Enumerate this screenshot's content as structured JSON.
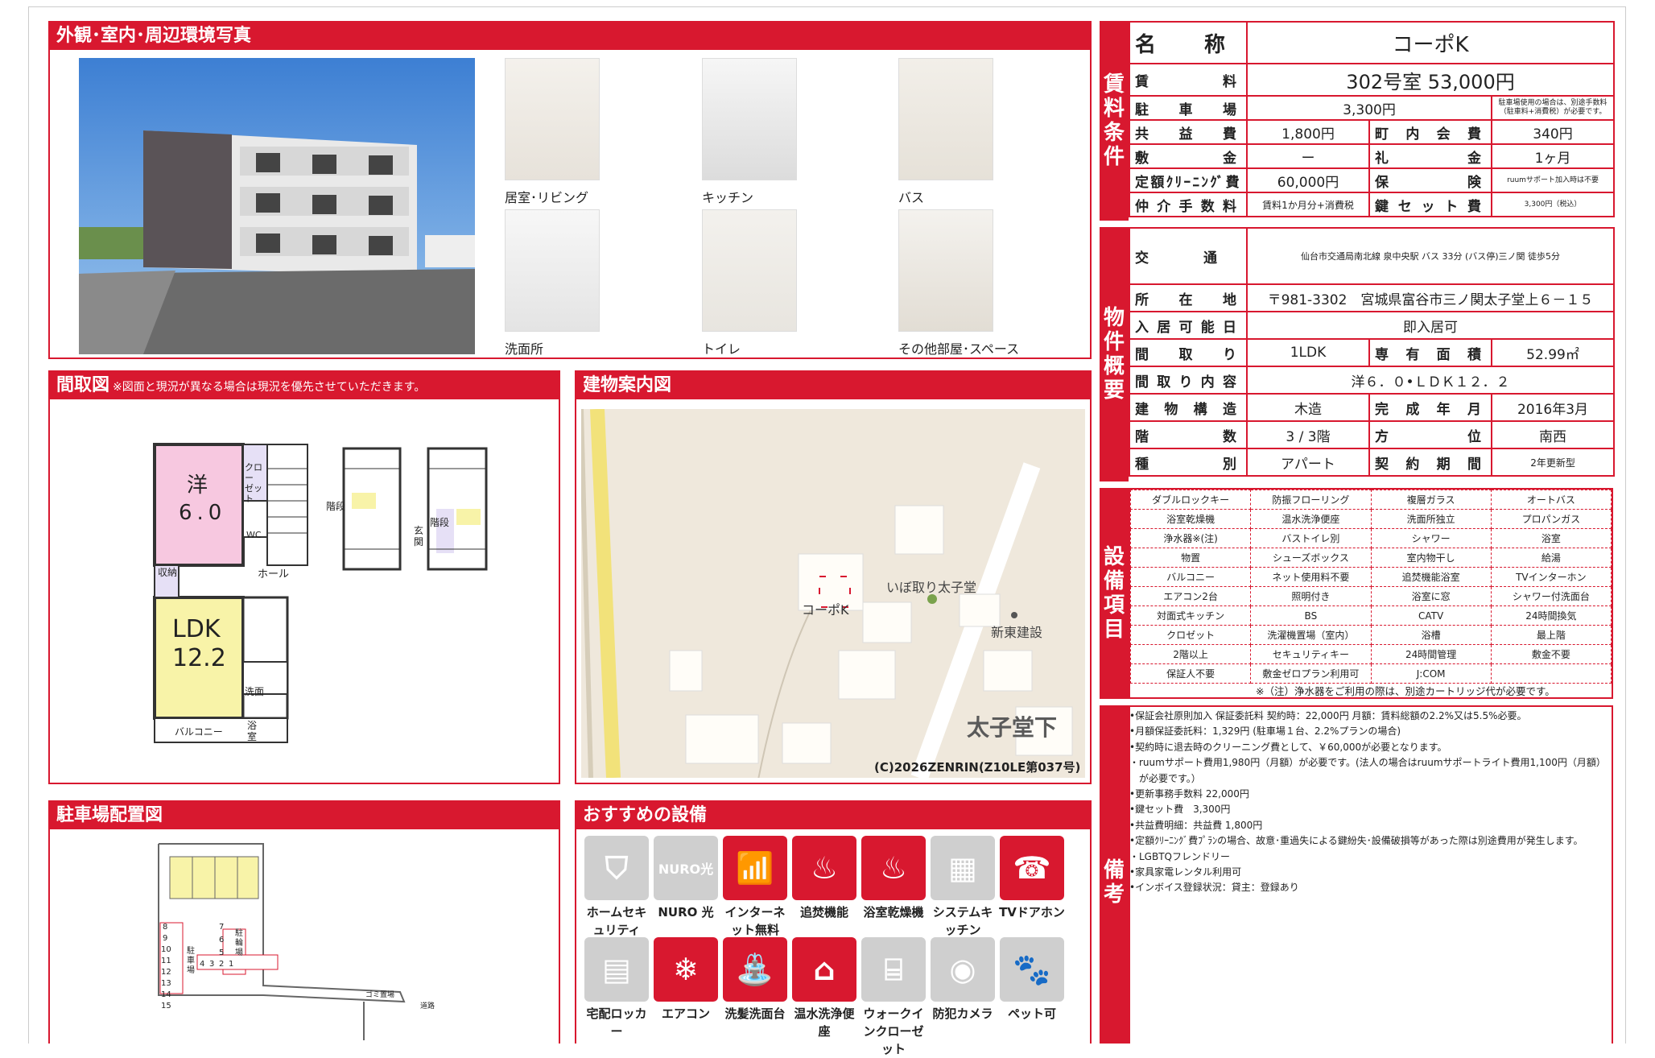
{
  "sections": {
    "photos": "外観･室内･周辺環境写真",
    "floorplan": "間取図",
    "floorplan_note": "※図面と現況が異なる場合は現況を優先させていただきます。",
    "map": "建物案内図",
    "parking": "駐車場配置図",
    "recommend": "おすすめの設備"
  },
  "photos": [
    {
      "caption": "居室･リビング"
    },
    {
      "caption": "キッチン"
    },
    {
      "caption": "バス"
    },
    {
      "caption": "洗面所"
    },
    {
      "caption": "トイレ"
    },
    {
      "caption": "その他部屋･スペース"
    }
  ],
  "floorplan_labels": {
    "western": "洋",
    "western_size": "6.0",
    "closet": "クロー\nゼット",
    "wc": "WC",
    "storage": "収納",
    "hall": "ホール",
    "ldk": "LDK",
    "ldk_size": "12.2",
    "washroom": "洗面",
    "bath": "浴室",
    "balcony": "バルコニー",
    "stairs": "階段",
    "entrance": "玄関"
  },
  "map": {
    "building": "コーポK",
    "label1": "いぼ取り太子堂",
    "label2": "新東建設",
    "area": "太子堂下",
    "copyright": "(C)2026ZENRIN(Z10LE第037号)"
  },
  "parking_map": {
    "numbers_left": [
      "8",
      "9",
      "10",
      "11",
      "12",
      "13",
      "14",
      "15"
    ],
    "numbers_mid": [
      "7",
      "6",
      "5",
      "4",
      "3",
      "2",
      "1"
    ],
    "bike": "駐輪場",
    "lot": "駐車場",
    "garbage": "ゴミ置場",
    "road": "道路"
  },
  "rent_side": "賃料条件",
  "overview_side": "物件概要",
  "equipment_side": "設備項目",
  "remarks_side": "備考",
  "rent": {
    "name_k": "名称",
    "name_v": "コーポK",
    "rent_k": "賃料",
    "rent_v": "302号室 53,000円",
    "parking_k": "駐車場",
    "parking_v": "3,300円",
    "parking_note": "駐車場使用の場合は、別途手数料（駐車料+消費税）が必要です。",
    "common_k": "共益費",
    "common_v": "1,800円",
    "town_k": "町内会費",
    "town_v": "340円",
    "deposit_k": "敷金",
    "deposit_v": "ー",
    "key_k": "礼金",
    "key_v": "1ヶ月",
    "clean_k": "定額ｸﾘｰﾆﾝｸﾞ費",
    "clean_v": "60,000円",
    "ins_k": "保険",
    "ins_v": "ruumサポート加入時は不要",
    "fee_k": "仲介手数料",
    "fee_v": "賃料1か月分+消費税",
    "keyset_k": "鍵セット費",
    "keyset_v": "3,300円（税込）"
  },
  "overview": {
    "traffic_k": "交通",
    "traffic_v": "仙台市交通局南北線 泉中央駅 バス 33分 (バス停)三ノ関 徒歩5分",
    "addr_k": "所在地",
    "addr_v": "〒981-3302　宮城県富谷市三ノ関太子堂上６－１５",
    "move_k": "入居可能日",
    "move_v": "即入居可",
    "layout_k": "間取り",
    "layout_v": "1LDK",
    "area_k": "専有面積",
    "area_v": "52.99㎡",
    "detail_k": "間取り内容",
    "detail_v": "洋６．０•ＬＤＫ１２．２",
    "struct_k": "建物構造",
    "struct_v": "木造",
    "built_k": "完成年月",
    "built_v": "2016年3月",
    "floor_k": "階数",
    "floor_v": "3 / 3階",
    "dir_k": "方位",
    "dir_v": "南西",
    "type_k": "種別",
    "type_v": "アパート",
    "contract_k": "契約期間",
    "contract_v": "2年更新型"
  },
  "equipment": [
    [
      "ダブルロックキー",
      "防振フローリング",
      "複層ガラス",
      "オートバス"
    ],
    [
      "浴室乾燥機",
      "温水洗浄便座",
      "洗面所独立",
      "プロパンガス"
    ],
    [
      "浄水器※(注)",
      "バストイレ別",
      "シャワー",
      "浴室"
    ],
    [
      "物置",
      "シューズボックス",
      "室内物干し",
      "給湯"
    ],
    [
      "バルコニー",
      "ネット使用料不要",
      "追焚機能浴室",
      "TVインターホン"
    ],
    [
      "エアコン2台",
      "照明付き",
      "浴室に窓",
      "シャワー付洗面台"
    ],
    [
      "対面式キッチン",
      "BS",
      "CATV",
      "24時間換気"
    ],
    [
      "クロゼット",
      "洗濯機置場（室内）",
      "浴槽",
      "最上階"
    ],
    [
      "2階以上",
      "セキュリティキー",
      "24時間管理",
      "敷金不要"
    ],
    [
      "保証人不要",
      "敷金ゼロプラン利用可",
      "J:COM",
      ""
    ]
  ],
  "equipment_note": "※（注）浄水器をご利用の際は、別途カートリッジ代が必要です。",
  "remarks": [
    "•保証会社原則加入 保証委託料 契約時：22,000円 月額：賃料総額の2.2%又は5.5%必要。",
    "•月額保証委託料：1,329円 (駐車場１台、2.2%プランの場合)",
    "•契約時に退去時のクリーニング費として、￥60,000が必要となります。",
    "・ruumサポート費用1,980円（月額）が必要です。(法人の場合はruumサポートライト費用1,100円（月額）",
    "　が必要です。）",
    "•更新事務手数料 22,000円",
    "•鍵セット費　3,300円",
    "•共益費明細：共益費 1,800円",
    "•定額ｸﾘｰﾆﾝｸﾞ費ﾌﾟﾗﾝの場合、故意･重過失による鍵紛失･設備破損等があった際は別途費用が発生します。",
    "・LGBTQフレンドリー",
    "•家具家電レンタル利用可",
    "•インボイス登録状況：貸主：登録あり"
  ],
  "recommend_items": [
    {
      "label": "ホームセキュリティ",
      "style": "gray",
      "icon": "shield-icon"
    },
    {
      "label": "NURO 光",
      "style": "gray",
      "icon": "nuro-icon"
    },
    {
      "label": "インターネット無料",
      "style": "red",
      "icon": "wifi-icon"
    },
    {
      "label": "追焚機能",
      "style": "red",
      "icon": "bathtub-icon"
    },
    {
      "label": "浴室乾燥機",
      "style": "red",
      "icon": "bath-dryer-icon"
    },
    {
      "label": "システムキッチン",
      "style": "gray",
      "icon": "kitchen-icon"
    },
    {
      "label": "TVドアホン",
      "style": "red",
      "icon": "intercom-icon"
    },
    {
      "label": "宅配ロッカー",
      "style": "gray",
      "icon": "locker-icon"
    },
    {
      "label": "エアコン",
      "style": "red",
      "icon": "aircon-icon"
    },
    {
      "label": "洗髪洗面台",
      "style": "red",
      "icon": "washbasin-icon"
    },
    {
      "label": "温水洗浄便座",
      "style": "red",
      "icon": "toilet-icon"
    },
    {
      "label": "ウォークインクローゼット",
      "style": "gray",
      "icon": "closet-icon"
    },
    {
      "label": "防犯カメラ",
      "style": "gray",
      "icon": "camera-icon"
    },
    {
      "label": "ペット可",
      "style": "gray",
      "icon": "paw-icon"
    }
  ],
  "colors": {
    "accent": "#d8182f"
  }
}
